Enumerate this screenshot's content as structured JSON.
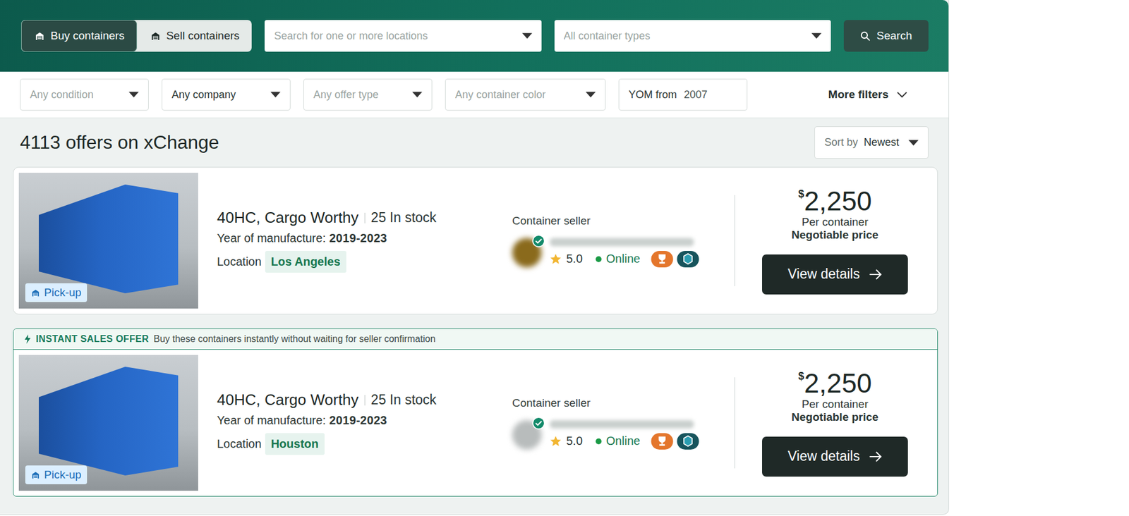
{
  "mode_tabs": [
    {
      "label": "Buy containers",
      "selected": true
    },
    {
      "label": "Sell containers",
      "selected": false
    }
  ],
  "search": {
    "location_placeholder": "Search for one or more locations",
    "type_placeholder": "All container types",
    "button": "Search"
  },
  "filters": [
    {
      "label": "Any condition",
      "placeholder": true
    },
    {
      "label": "Any company",
      "placeholder": false
    },
    {
      "label": "Any offer type",
      "placeholder": true
    },
    {
      "label": "Any container color",
      "placeholder": true
    }
  ],
  "yom": {
    "label": "YOM from",
    "value": "2007"
  },
  "more_filters": "More filters",
  "results": {
    "count_text": "4113 offers on xChange",
    "sort_label": "Sort by",
    "sort_value": "Newest"
  },
  "offers": [
    {
      "kind": "standard",
      "banner": null,
      "title": "40HC, Cargo Worthy",
      "stock": "25 In stock",
      "yom_label": "Year of manufacture:",
      "yom": "2019-2023",
      "location_label": "Location",
      "location": "Los Angeles",
      "delivery": "Pick-up",
      "seller_label": "Container seller",
      "avatar_color": "#8a6a1c",
      "verified": true,
      "rating": "5.0",
      "status": "Online",
      "online": true,
      "currency": "$",
      "price": "2,250",
      "price_unit": "Per container",
      "price_note": "Negotiable price",
      "button": "View details"
    },
    {
      "kind": "instant",
      "banner": {
        "title": "INSTANT SALES OFFER",
        "text": "Buy these containers instantly without waiting for seller confirmation"
      },
      "title": "40HC, Cargo Worthy",
      "stock": "25 In stock",
      "yom_label": "Year of manufacture:",
      "yom": "2019-2023",
      "location_label": "Location",
      "location": "Houston",
      "delivery": "Pick-up",
      "seller_label": "Container seller",
      "avatar_color": "#b8bcbc",
      "verified": true,
      "rating": "5.0",
      "status": "Online",
      "online": true,
      "currency": "$",
      "price": "2,250",
      "price_unit": "Per container",
      "price_note": "Negotiable price",
      "button": "View details"
    }
  ]
}
